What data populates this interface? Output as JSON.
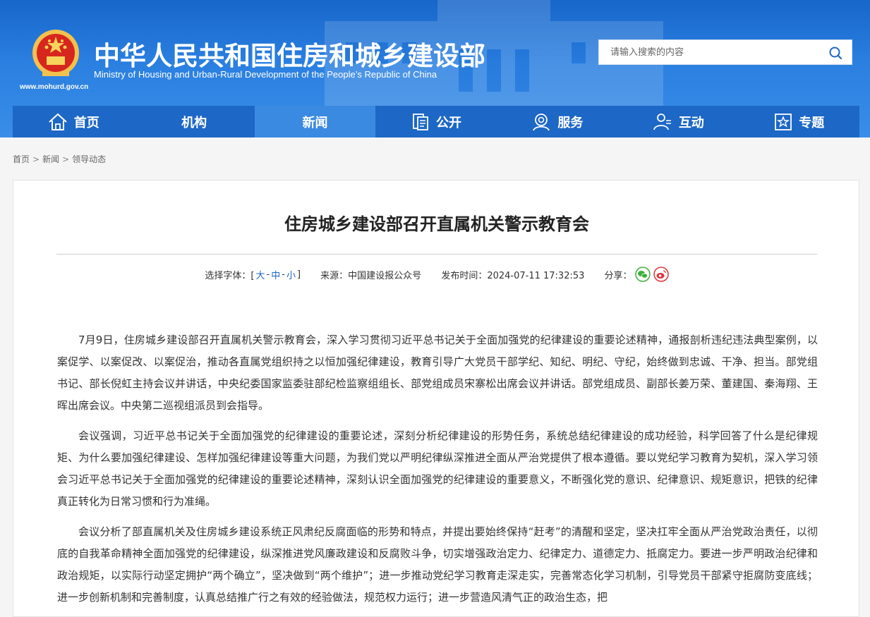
{
  "header": {
    "title": "中华人民共和国住房和城乡建设部",
    "subtitle": "Ministry of Housing and Urban-Rural Development of the People’s Republic of China",
    "url": "www.mohurd.gov.cn",
    "emblem_icon": "national-emblem-icon",
    "colors": {
      "primary": "#1d67c6",
      "header_bg": "#2a7fe0",
      "active_nav": "#3a8ae2"
    }
  },
  "search": {
    "placeholder": "请输入搜索的内容",
    "icon": "search-icon"
  },
  "nav": {
    "items": [
      {
        "label": "首页",
        "icon": "home-icon"
      },
      {
        "label": "机构",
        "icon": ""
      },
      {
        "label": "新闻",
        "icon": "",
        "active": true
      },
      {
        "label": "公开",
        "icon": "document-icon"
      },
      {
        "label": "服务",
        "icon": "service-icon"
      },
      {
        "label": "互动",
        "icon": "interact-icon"
      },
      {
        "label": "专题",
        "icon": "star-box-icon"
      }
    ]
  },
  "breadcrumb": {
    "items": [
      "首页",
      "新闻",
      "领导动态"
    ],
    "sep": ">"
  },
  "article": {
    "title": "住房城乡建设部召开直属机关警示教育会",
    "meta": {
      "font_label": "选择字体：[",
      "font_large": "大",
      "font_mid": "中",
      "font_small": "小",
      "font_close": "]",
      "source": "来源：中国建设报公众号",
      "published": "发布时间：2024-07-11 17:32:53",
      "share_label": "分享：",
      "share_wechat_icon": "wechat-icon",
      "share_weibo_icon": "weibo-icon"
    },
    "paragraphs": [
      "7月9日，住房城乡建设部召开直属机关警示教育会，深入学习贯彻习近平总书记关于全面加强党的纪律建设的重要论述精神，通报剖析违纪违法典型案例，以案促学、以案促改、以案促治，推动各直属党组织持之以恒加强纪律建设，教育引导广大党员干部学纪、知纪、明纪、守纪，始终做到忠诚、干净、担当。部党组书记、部长倪虹主持会议并讲话，中央纪委国家监委驻部纪检监察组组长、部党组成员宋寨松出席会议并讲话。部党组成员、副部长姜万荣、董建国、秦海翔、王晖出席会议。中央第二巡视组派员到会指导。",
      "会议强调，习近平总书记关于全面加强党的纪律建设的重要论述，深刻分析纪律建设的形势任务，系统总结纪律建设的成功经验，科学回答了什么是纪律规矩、为什么要加强纪律建设、怎样加强纪律建设等重大问题，为我们党以严明纪律纵深推进全面从严治党提供了根本遵循。要以党纪学习教育为契机，深入学习领会习近平总书记关于全面加强党的纪律建设的重要论述精神，深刻认识全面加强党的纪律建设的重要意义，不断强化党的意识、纪律意识、规矩意识，把铁的纪律真正转化为日常习惯和行为准绳。",
      "会议分析了部直属机关及住房城乡建设系统正风肃纪反腐面临的形势和特点，并提出要始终保持“赶考”的清醒和坚定，坚决扛牢全面从严治党政治责任，以彻底的自我革命精神全面加强党的纪律建设，纵深推进党风廉政建设和反腐败斗争，切实增强政治定力、纪律定力、道德定力、抵腐定力。要进一步严明政治纪律和政治规矩，以实际行动坚定拥护“两个确立”，坚决做到“两个维护”；进一步推动党纪学习教育走深走实，完善常态化学习机制，引导党员干部紧守拒腐防变底线；进一步创新机制和完善制度，认真总结推广行之有效的经验做法，规范权力运行；进一步营造风清气正的政治生态，把"
    ]
  }
}
